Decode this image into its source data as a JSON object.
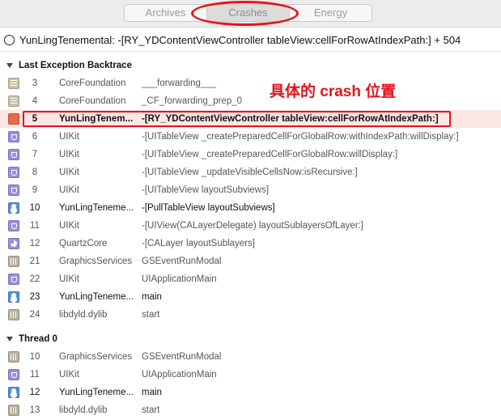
{
  "tabs": [
    {
      "label": "Archives",
      "active": false
    },
    {
      "label": "Crashes",
      "active": true
    },
    {
      "label": "Energy",
      "active": false
    }
  ],
  "title": "YunLingTenemental: -[RY_YDContentViewController tableView:cellForRowAtIndexPath:] + 504",
  "annotation": "具体的 crash 位置",
  "colors": {
    "accent_red": "#e5141b",
    "highlight_row": "#fde6e6"
  },
  "sections": [
    {
      "header": "Last Exception Backtrace",
      "rows": [
        {
          "icon": "library-icon",
          "num": "3",
          "lib": "CoreFoundation",
          "sym": "___forwarding___"
        },
        {
          "icon": "library-icon",
          "num": "4",
          "lib": "CoreFoundation",
          "sym": "_CF_forwarding_prep_0"
        },
        {
          "icon": "user-code-icon",
          "num": "5",
          "lib": "YunLingTenem...",
          "sym": "-[RY_YDContentViewController tableView:cellForRowAtIndexPath:]",
          "highlight": true
        },
        {
          "icon": "uikit-icon",
          "num": "6",
          "lib": "UIKit",
          "sym": "-[UITableView _createPreparedCellForGlobalRow:withIndexPath:willDisplay:]"
        },
        {
          "icon": "uikit-icon",
          "num": "7",
          "lib": "UIKit",
          "sym": "-[UITableView _createPreparedCellForGlobalRow:willDisplay:]"
        },
        {
          "icon": "uikit-icon",
          "num": "8",
          "lib": "UIKit",
          "sym": "-[UITableView _updateVisibleCellsNow:isRecursive:]"
        },
        {
          "icon": "uikit-icon",
          "num": "9",
          "lib": "UIKit",
          "sym": "-[UITableView layoutSubviews]"
        },
        {
          "icon": "user-code-icon",
          "num": "10",
          "lib": "YunLingTeneme...",
          "sym": "-[PullTableView layoutSubviews]",
          "user": true
        },
        {
          "icon": "uikit-icon",
          "num": "11",
          "lib": "UIKit",
          "sym": "-[UIView(CALayerDelegate) layoutSublayersOfLayer:]"
        },
        {
          "icon": "quartz-icon",
          "num": "12",
          "lib": "QuartzCore",
          "sym": "-[CALayer layoutSublayers]"
        },
        {
          "icon": "system-icon",
          "num": "21",
          "lib": "GraphicsServices",
          "sym": "GSEventRunModal"
        },
        {
          "icon": "uikit-icon",
          "num": "22",
          "lib": "UIKit",
          "sym": "UIApplicationMain"
        },
        {
          "icon": "user-code-icon",
          "num": "23",
          "lib": "YunLingTeneme...",
          "sym": "main",
          "user": true
        },
        {
          "icon": "system-icon",
          "num": "24",
          "lib": "libdyld.dylib",
          "sym": "start"
        }
      ]
    },
    {
      "header": "Thread 0",
      "rows": [
        {
          "icon": "system-icon",
          "num": "10",
          "lib": "GraphicsServices",
          "sym": "GSEventRunModal"
        },
        {
          "icon": "uikit-icon",
          "num": "11",
          "lib": "UIKit",
          "sym": "UIApplicationMain"
        },
        {
          "icon": "user-code-icon",
          "num": "12",
          "lib": "YunLingTeneme...",
          "sym": "main",
          "user": true
        },
        {
          "icon": "system-icon",
          "num": "13",
          "lib": "libdyld.dylib",
          "sym": "start"
        }
      ]
    }
  ]
}
